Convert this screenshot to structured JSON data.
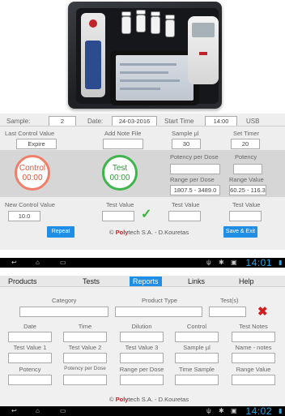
{
  "colors": {
    "accent": "#1f8fe6",
    "control_ring": "#f07f6a",
    "test_ring": "#3fb54b",
    "check": "#35b53b",
    "brand_red": "#c0232a",
    "clock": "#29a6e6"
  },
  "top": {
    "sample_label": "Sample:",
    "sample_value": "2",
    "date_label": "Date:",
    "date_value": "24-03-2016",
    "start_time_label": "Start Time",
    "start_time_value": "14:00",
    "usb_label": "USB"
  },
  "row1": {
    "last_control_label": "Last Control Value",
    "last_control_value": "Expire",
    "add_note_label": "Add Note File",
    "add_note_value": "",
    "sample_ul_label": "Sample µl",
    "sample_ul_value": "30",
    "set_timer_label": "Set Timer",
    "set_timer_value": "20"
  },
  "band": {
    "control_title": "Control",
    "control_time": "00:00",
    "test_title": "Test",
    "test_time": "00:00",
    "potency_per_dose_label": "Potency per Dose",
    "potency_per_dose_value": "",
    "potency_label": "Potency",
    "potency_value": "",
    "range_per_dose_label": "Range per Dose",
    "range_per_dose_value": "1807.5 - 3489.0",
    "range_value_label": "Range Value",
    "range_value_value": "60.25 - 116.3"
  },
  "row3": {
    "new_control_label": "New Control Value",
    "new_control_value": "10.0",
    "test_value_label_1": "Test Value",
    "test_value_1": "",
    "test_value_label_2": "Test Value",
    "test_value_2": "",
    "test_value_label_3": "Test Value",
    "test_value_3": "",
    "check_glyph": "✓"
  },
  "actions": {
    "repeat": "Repeat",
    "save_exit": "Save & Exit"
  },
  "footer": {
    "copyright": "© ",
    "brand_poly": "Poly",
    "brand_rest": "tech S.A. - D.Kouretas"
  },
  "statusbar1": {
    "time": "14:01"
  },
  "menu": {
    "items": [
      "Products",
      "Tests",
      "Reports",
      "Links",
      "Help"
    ],
    "active": "Reports"
  },
  "reports": {
    "category_label": "Category",
    "product_type_label": "Product Type",
    "tests_label": "Test(s)",
    "close_glyph": "✖",
    "row_a": [
      "Date",
      "Time",
      "Dilution",
      "Control",
      "Test Notes"
    ],
    "row_b": [
      "Test Value 1",
      "Test Value 2",
      "Test Value 3",
      "Sample µl",
      "Name - notes"
    ],
    "row_c": [
      "Potency",
      "Potency per Dose",
      "Range per Dose",
      "Time Sample",
      "Range Value"
    ]
  },
  "footer2": {
    "copyright": "© ",
    "brand_poly": "Poly",
    "brand_rest": "tech S.A. - D.Kouretas"
  },
  "statusbar2": {
    "time": "14:02"
  },
  "icons": [
    "back-icon",
    "home-icon",
    "recent-apps-icon",
    "usb-icon",
    "android-debug-icon",
    "image-icon",
    "battery-icon"
  ]
}
